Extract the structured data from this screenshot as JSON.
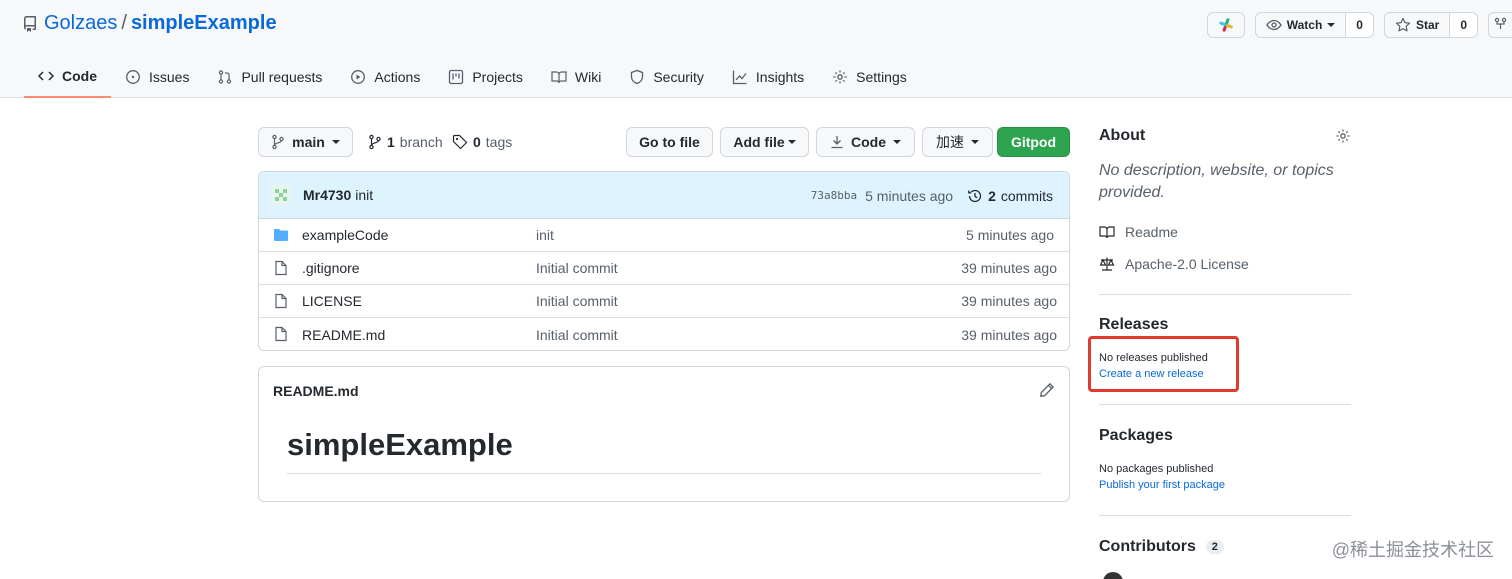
{
  "repo": {
    "owner": "Golzaes",
    "separator": "/",
    "name": "simpleExample"
  },
  "header_actions": {
    "watch_label": "Watch",
    "watch_count": "0",
    "star_label": "Star",
    "star_count": "0"
  },
  "tabs": [
    {
      "label": "Code",
      "icon": "code-icon",
      "active": true
    },
    {
      "label": "Issues",
      "icon": "issue-opened-icon"
    },
    {
      "label": "Pull requests",
      "icon": "git-pull-request-icon"
    },
    {
      "label": "Actions",
      "icon": "play-icon"
    },
    {
      "label": "Projects",
      "icon": "project-icon"
    },
    {
      "label": "Wiki",
      "icon": "book-icon"
    },
    {
      "label": "Security",
      "icon": "shield-icon"
    },
    {
      "label": "Insights",
      "icon": "graph-icon"
    },
    {
      "label": "Settings",
      "icon": "gear-icon"
    }
  ],
  "toolbar": {
    "branch": "main",
    "branch_count": "1",
    "branch_label": "branch",
    "tag_count": "0",
    "tag_label": "tags",
    "go_to_file": "Go to file",
    "add_file": "Add file",
    "code": "Code",
    "accelerate": "加速",
    "gitpod": "Gitpod"
  },
  "latest_commit": {
    "author": "Mr4730",
    "message": "init",
    "sha": "73a8bba",
    "age": "5 minutes ago",
    "commit_count": "2",
    "commit_label": "commits"
  },
  "files": [
    {
      "name": "exampleCode",
      "type": "dir",
      "message": "init",
      "age": "5 minutes ago"
    },
    {
      "name": ".gitignore",
      "type": "file",
      "message": "Initial commit",
      "age": "39 minutes ago"
    },
    {
      "name": "LICENSE",
      "type": "file",
      "message": "Initial commit",
      "age": "39 minutes ago"
    },
    {
      "name": "README.md",
      "type": "file",
      "message": "Initial commit",
      "age": "39 minutes ago"
    }
  ],
  "readme": {
    "filename": "README.md",
    "heading": "simpleExample"
  },
  "sidebar": {
    "about_title": "About",
    "about_desc": "No description, website, or topics provided.",
    "readme_link": "Readme",
    "license_link": "Apache-2.0 License",
    "releases_title": "Releases",
    "releases_none": "No releases published",
    "releases_create": "Create a new release",
    "packages_title": "Packages",
    "packages_none": "No packages published",
    "packages_publish": "Publish your first package",
    "contributors_title": "Contributors",
    "contributors_count": "2"
  },
  "watermark": "@稀土掘金技术社区",
  "colors": {
    "link": "#0969da",
    "green": "#2da44e",
    "highlight": "#e03b2f",
    "tab_underline": "#fd8c73"
  }
}
